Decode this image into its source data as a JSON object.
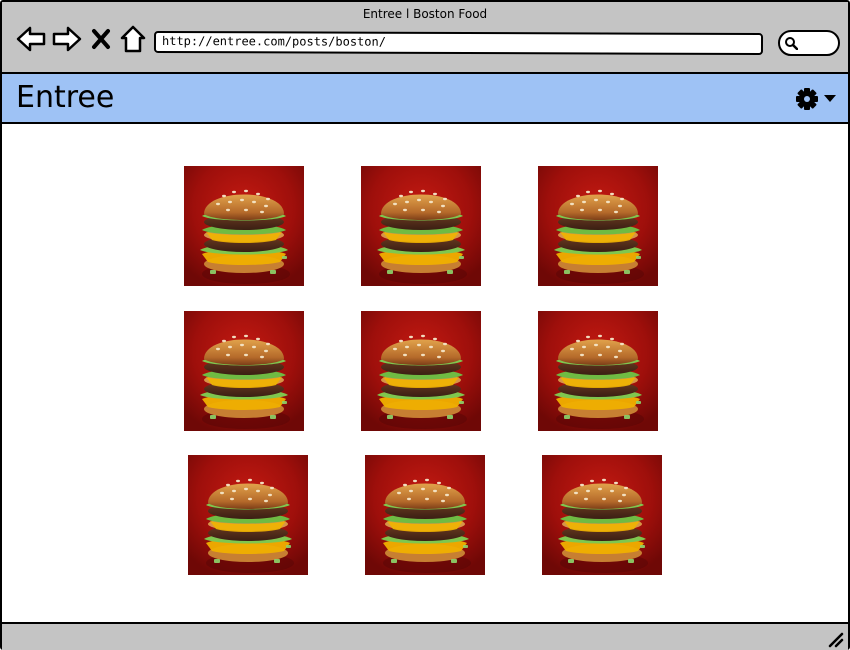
{
  "window": {
    "title": "Entree l Boston Food"
  },
  "browser": {
    "url": "http://entree.com/posts/boston/",
    "icons": [
      "back-arrow-icon",
      "forward-arrow-icon",
      "close-x-icon",
      "home-icon",
      "search-icon"
    ]
  },
  "app": {
    "brand": "Entree",
    "settings_icon": "gear-icon",
    "dropdown_icon": "chevron-down-icon"
  },
  "gallery": {
    "items": [
      {
        "kind": "burger"
      },
      {
        "kind": "burger"
      },
      {
        "kind": "burger"
      },
      {
        "kind": "burger"
      },
      {
        "kind": "burger"
      },
      {
        "kind": "burger"
      },
      {
        "kind": "burger"
      },
      {
        "kind": "burger"
      },
      {
        "kind": "burger"
      }
    ]
  }
}
